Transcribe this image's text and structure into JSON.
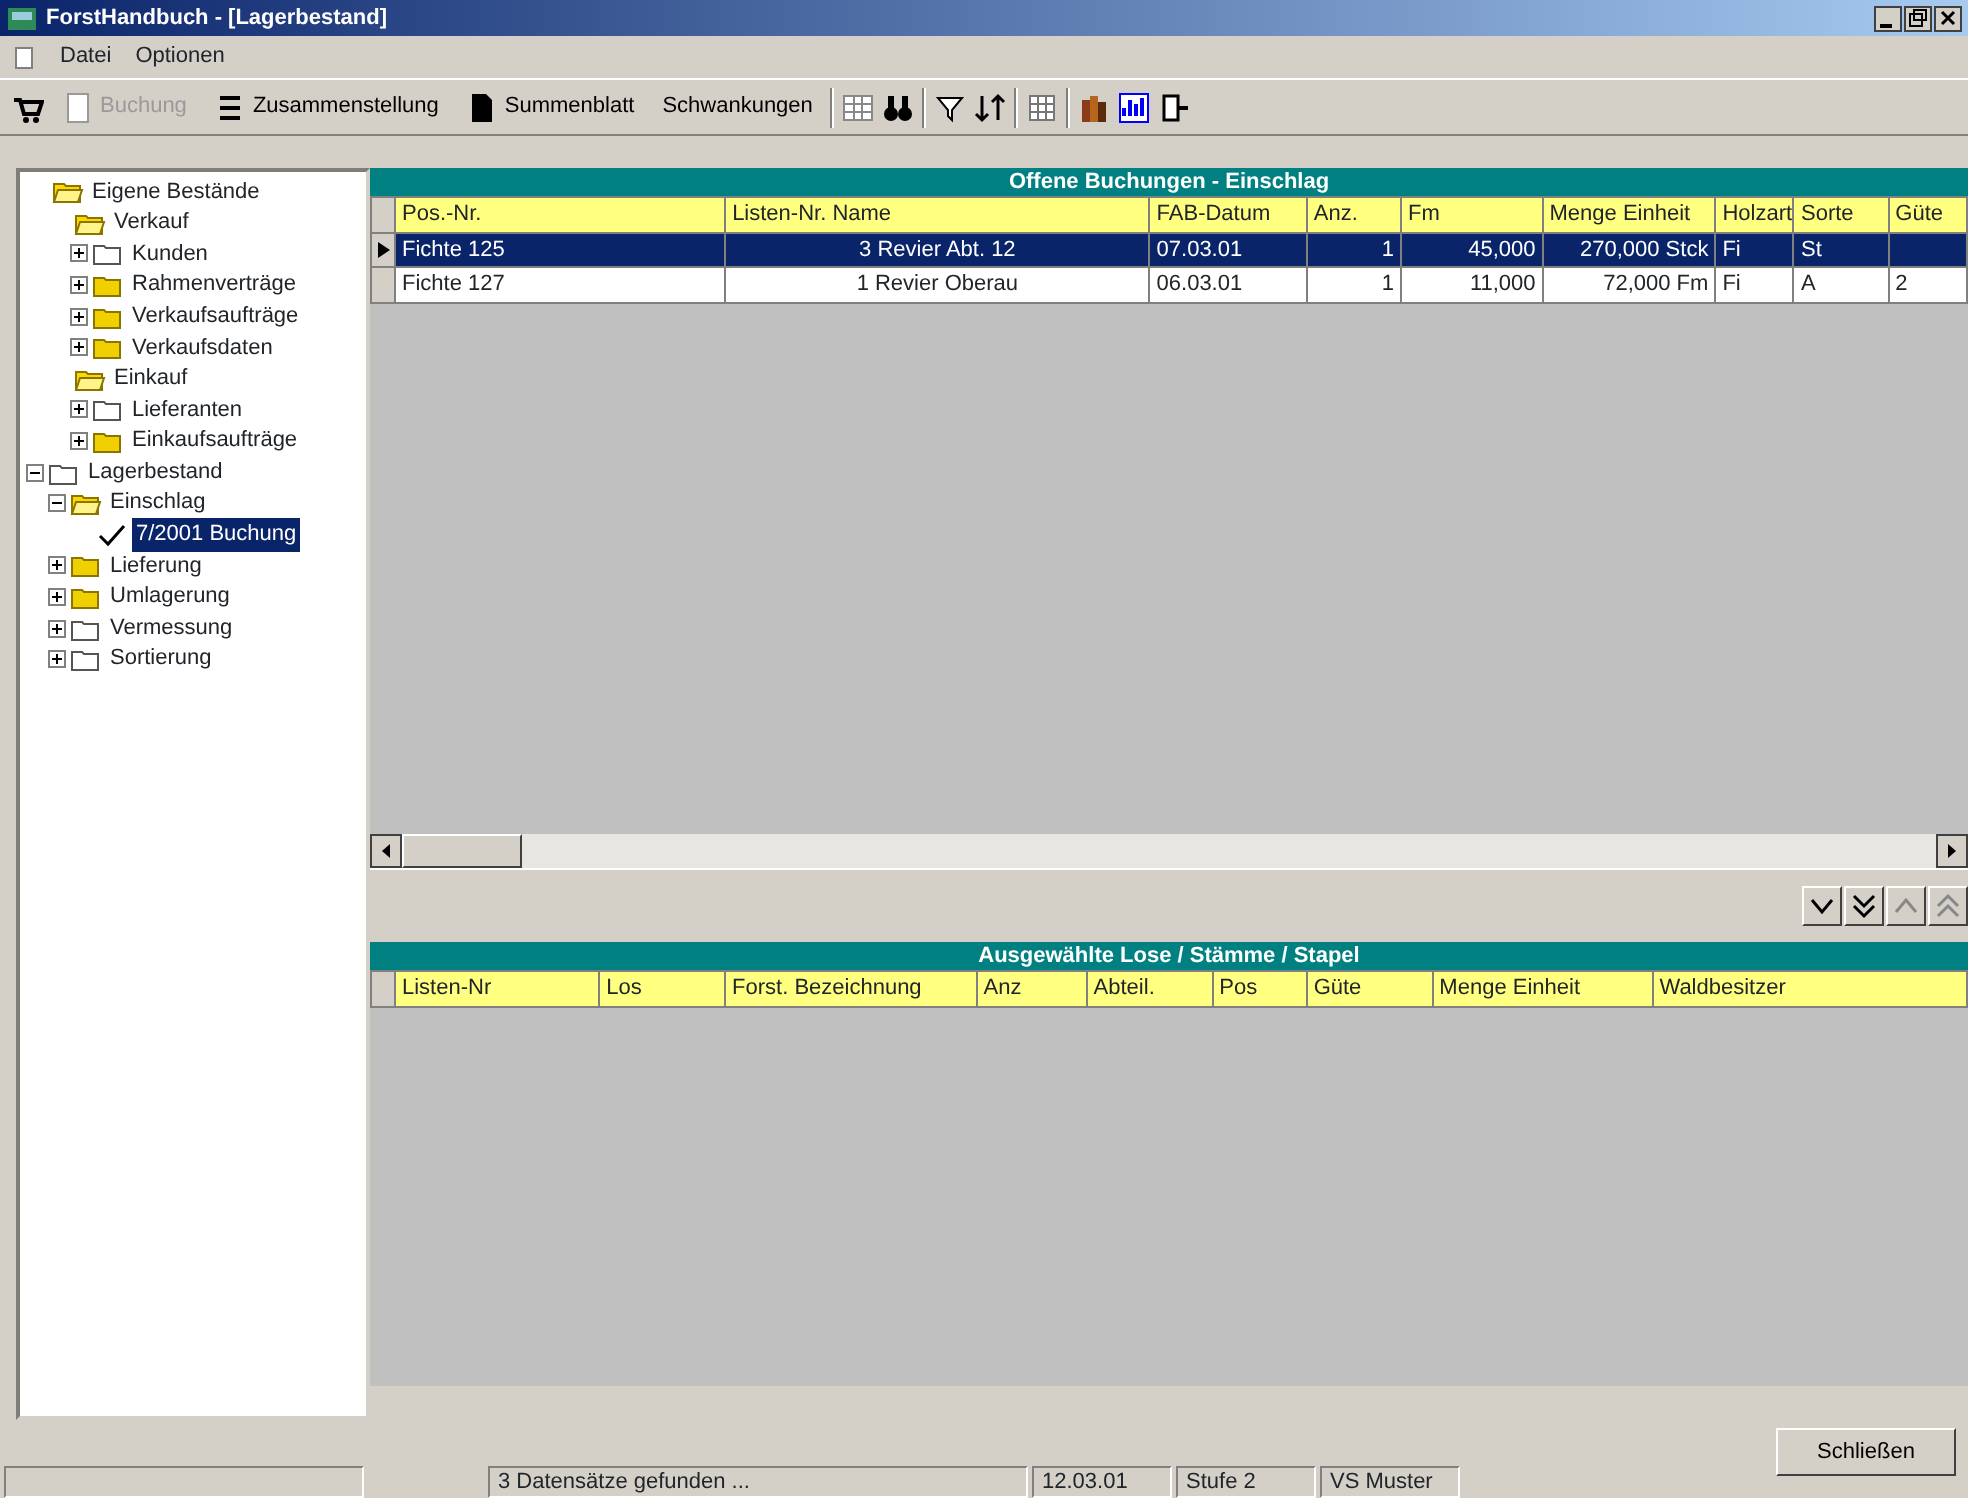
{
  "window": {
    "title": "ForstHandbuch - [Lagerbestand]"
  },
  "menu": [
    "Datei",
    "Optionen"
  ],
  "toolbar": [
    {
      "label": "Buchung",
      "disabled": true
    },
    {
      "label": "Zusammenstellung",
      "disabled": false
    },
    {
      "label": "Summenblatt",
      "disabled": false
    },
    {
      "label": "Schwankungen",
      "disabled": false
    }
  ],
  "tree": [
    {
      "label": "Eigene Bestände",
      "kind": "open",
      "children": [
        {
          "label": "Verkauf",
          "kind": "open",
          "children": [
            {
              "label": "Kunden",
              "kind": "plain",
              "expanded": false
            },
            {
              "label": "Rahmenverträge",
              "kind": "folder",
              "expanded": false
            },
            {
              "label": "Verkaufsaufträge",
              "kind": "folder",
              "expanded": false
            },
            {
              "label": "Verkaufsdaten",
              "kind": "folder",
              "expanded": false
            }
          ]
        },
        {
          "label": "Einkauf",
          "kind": "open",
          "children": [
            {
              "label": "Lieferanten",
              "kind": "plain",
              "expanded": false
            },
            {
              "label": "Einkaufsaufträge",
              "kind": "folder",
              "expanded": false
            }
          ]
        }
      ]
    },
    {
      "label": "Lagerbestand",
      "kind": "plain",
      "expanded": true,
      "children": [
        {
          "label": "Einschlag",
          "kind": "open",
          "expanded": true,
          "children": [
            {
              "label": "7/2001 Buchung",
              "kind": "leaf",
              "selected": true
            }
          ]
        },
        {
          "label": "Lieferung",
          "kind": "folder",
          "expanded": false
        },
        {
          "label": "Umlagerung",
          "kind": "folder",
          "expanded": false
        },
        {
          "label": "Vermessung",
          "kind": "plain",
          "expanded": false
        },
        {
          "label": "Sortierung",
          "kind": "plain",
          "expanded": false
        }
      ]
    }
  ],
  "bookings": {
    "title": "Offene Buchungen - Einschlag",
    "columns": [
      "Pos.-Nr.",
      "Listen-Nr. Name",
      "FAB-Datum",
      "Anz.",
      "Fm",
      "Menge Einheit",
      "Holzart",
      "Sorte",
      "Güte"
    ],
    "rows": [
      {
        "selected": true,
        "cells": [
          "Fichte 125",
          "3 Revier Abt. 12",
          "07.03.01",
          "1",
          "45,000",
          "270,000 Stck",
          "Fi",
          "St",
          ""
        ]
      },
      {
        "selected": false,
        "cells": [
          "Fichte 127",
          "1 Revier Oberau",
          "06.03.01",
          "1",
          "11,000",
          "72,000 Fm",
          "Fi",
          "A",
          "2"
        ]
      }
    ]
  },
  "selection": {
    "title": "Ausgewählte Lose / Stämme / Stapel",
    "columns": [
      "Listen-Nr",
      "Los",
      "Forst. Bezeichnung",
      "Anz",
      "Abteil.",
      "Pos",
      "Güte",
      "Menge Einheit",
      "Waldbesitzer"
    ]
  },
  "close_button": "Schließen",
  "status_bar": [
    "3 Datensätze gefunden ...",
    "12.03.01",
    "Stufe 2",
    "VS Muster"
  ]
}
